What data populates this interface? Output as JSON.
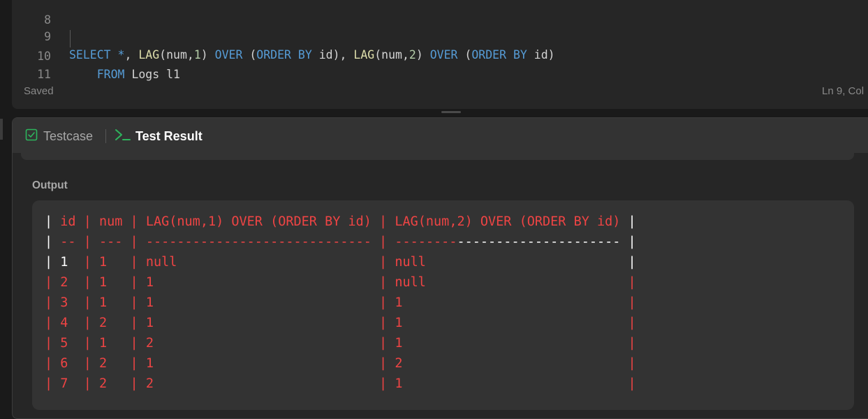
{
  "editor": {
    "lines": [
      {
        "number": "8",
        "code": ""
      },
      {
        "number": "9",
        "code": "SELECT *, LAG(num,1) OVER (ORDER BY id), LAG(num,2) OVER (ORDER BY id)"
      },
      {
        "number": "10",
        "code": "    FROM Logs l1"
      },
      {
        "number": "11",
        "code": ""
      }
    ],
    "status_saved": "Saved",
    "status_cursor": "Ln 9, Col"
  },
  "tabs": {
    "testcase_label": "Testcase",
    "result_label": "Test Result"
  },
  "output": {
    "label": "Output",
    "header": "| id | num | LAG(num,1) OVER (ORDER BY id) | LAG(num,2) OVER (ORDER BY id) |",
    "separator": "| -- | --- | ----------------------------- | ----------------------------- |",
    "rows": [
      "| 1  | 1   | null                          | null                          |",
      "| 2  | 1   | 1                             | null                          |",
      "| 3  | 1   | 1                             | 1                             |",
      "| 4  | 2   | 1                             | 1                             |",
      "| 5  | 1   | 2                             | 1                             |",
      "| 6  | 2   | 1                             | 2                             |",
      "| 7  | 2   | 2                             | 1                             |"
    ]
  },
  "colors": {
    "accent_green": "#2db55d",
    "result_red": "#ef4444",
    "keyword_blue": "#569cd6",
    "function_yellow": "#dcdcaa",
    "number_green": "#b5cea8"
  },
  "icons": {
    "testcase": "checkbox-icon",
    "result": "terminal-prompt-icon"
  }
}
